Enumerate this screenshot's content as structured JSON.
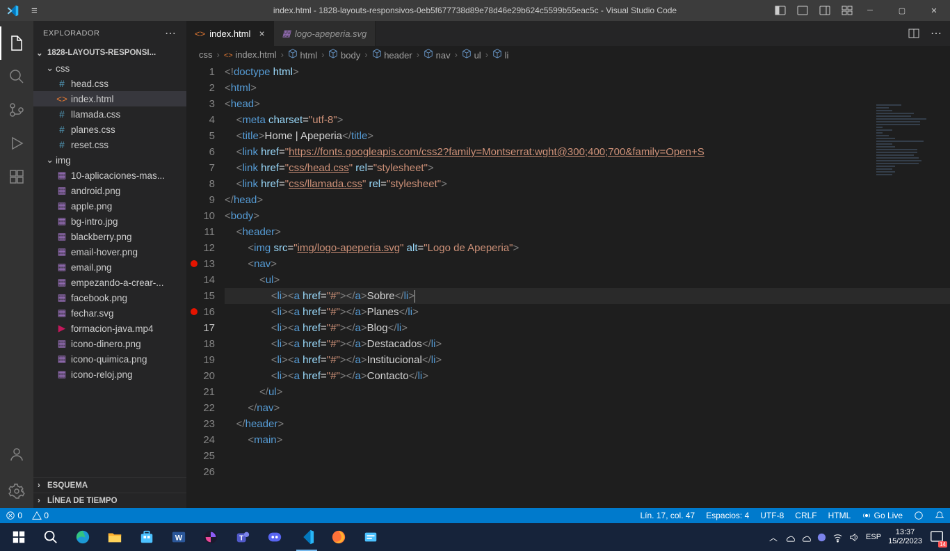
{
  "titlebar": {
    "title": "index.html - 1828-layouts-responsivos-0eb5f677738d89e78d46e29b624c5599b55eac5c - Visual Studio Code"
  },
  "sidebar": {
    "header": "EXPLORADOR",
    "root": "1828-LAYOUTS-RESPONSI...",
    "folders": [
      {
        "name": "css",
        "children": [
          "head.css",
          "index.html",
          "llamada.css",
          "planes.css",
          "reset.css"
        ]
      },
      {
        "name": "img",
        "children": [
          "10-aplicaciones-mas...",
          "android.png",
          "apple.png",
          "bg-intro.jpg",
          "blackberry.png",
          "email-hover.png",
          "email.png",
          "empezando-a-crear-...",
          "facebook.png",
          "fechar.svg",
          "formacion-java.mp4",
          "icono-dinero.png",
          "icono-quimica.png",
          "icono-reloj.png"
        ]
      }
    ],
    "footer": [
      "ESQUEMA",
      "LÍNEA DE TIEMPO"
    ]
  },
  "tabs": [
    {
      "name": "index.html",
      "active": true,
      "icon": "html"
    },
    {
      "name": "logo-apeperia.svg",
      "active": false,
      "icon": "svg"
    }
  ],
  "breadcrumbs": [
    "css",
    "index.html",
    "html",
    "body",
    "header",
    "nav",
    "ul",
    "li"
  ],
  "gutter": {
    "lines": 26,
    "breakpoints": [
      13,
      16
    ],
    "current": 17
  },
  "code": {
    "lines": [
      [
        {
          "c": "tk-gray",
          "t": "<!"
        },
        {
          "c": "tk-tag",
          "t": "doctype "
        },
        {
          "c": "tk-attr",
          "t": "html"
        },
        {
          "c": "tk-gray",
          "t": ">"
        }
      ],
      [
        {
          "c": "tk-gray",
          "t": "<"
        },
        {
          "c": "tk-tag",
          "t": "html"
        },
        {
          "c": "tk-gray",
          "t": ">"
        }
      ],
      [
        {
          "c": "tk-gray",
          "t": "<"
        },
        {
          "c": "tk-tag",
          "t": "head"
        },
        {
          "c": "tk-gray",
          "t": ">"
        }
      ],
      [
        {
          "c": "tk-txt",
          "t": "    "
        },
        {
          "c": "tk-gray",
          "t": "<"
        },
        {
          "c": "tk-tag",
          "t": "meta "
        },
        {
          "c": "tk-attr",
          "t": "charset"
        },
        {
          "c": "tk-txt",
          "t": "="
        },
        {
          "c": "tk-str",
          "t": "\"utf-8\""
        },
        {
          "c": "tk-gray",
          "t": ">"
        }
      ],
      [
        {
          "c": "tk-txt",
          "t": "    "
        },
        {
          "c": "tk-gray",
          "t": "<"
        },
        {
          "c": "tk-tag",
          "t": "title"
        },
        {
          "c": "tk-gray",
          "t": ">"
        },
        {
          "c": "tk-txt",
          "t": "Home | Apeperia"
        },
        {
          "c": "tk-gray",
          "t": "</"
        },
        {
          "c": "tk-tag",
          "t": "title"
        },
        {
          "c": "tk-gray",
          "t": ">"
        }
      ],
      [
        {
          "c": "tk-txt",
          "t": "    "
        },
        {
          "c": "tk-gray",
          "t": "<"
        },
        {
          "c": "tk-tag",
          "t": "link "
        },
        {
          "c": "tk-attr",
          "t": "href"
        },
        {
          "c": "tk-txt",
          "t": "="
        },
        {
          "c": "tk-str",
          "t": "\""
        },
        {
          "c": "tk-url",
          "t": "https://fonts.googleapis.com/css2?family=Montserrat:wght@300;400;700&family=Open+S"
        }
      ],
      [
        {
          "c": "tk-txt",
          "t": "    "
        },
        {
          "c": "tk-gray",
          "t": "<"
        },
        {
          "c": "tk-tag",
          "t": "link "
        },
        {
          "c": "tk-attr",
          "t": "href"
        },
        {
          "c": "tk-txt",
          "t": "="
        },
        {
          "c": "tk-str",
          "t": "\""
        },
        {
          "c": "tk-url",
          "t": "css/head.css"
        },
        {
          "c": "tk-str",
          "t": "\" "
        },
        {
          "c": "tk-attr",
          "t": "rel"
        },
        {
          "c": "tk-txt",
          "t": "="
        },
        {
          "c": "tk-str",
          "t": "\"stylesheet\""
        },
        {
          "c": "tk-gray",
          "t": ">"
        }
      ],
      [
        {
          "c": "tk-txt",
          "t": "    "
        },
        {
          "c": "tk-gray",
          "t": "<"
        },
        {
          "c": "tk-tag",
          "t": "link "
        },
        {
          "c": "tk-attr",
          "t": "href"
        },
        {
          "c": "tk-txt",
          "t": "="
        },
        {
          "c": "tk-str",
          "t": "\""
        },
        {
          "c": "tk-url",
          "t": "css/llamada.css"
        },
        {
          "c": "tk-str",
          "t": "\" "
        },
        {
          "c": "tk-attr",
          "t": "rel"
        },
        {
          "c": "tk-txt",
          "t": "="
        },
        {
          "c": "tk-str",
          "t": "\"stylesheet\""
        },
        {
          "c": "tk-gray",
          "t": ">"
        }
      ],
      [
        {
          "c": "tk-txt",
          "t": ""
        }
      ],
      [
        {
          "c": "tk-gray",
          "t": "</"
        },
        {
          "c": "tk-tag",
          "t": "head"
        },
        {
          "c": "tk-gray",
          "t": ">"
        }
      ],
      [
        {
          "c": "tk-txt",
          "t": ""
        }
      ],
      [
        {
          "c": "tk-gray",
          "t": "<"
        },
        {
          "c": "tk-tag",
          "t": "body"
        },
        {
          "c": "tk-gray",
          "t": ">"
        }
      ],
      [
        {
          "c": "tk-txt",
          "t": "    "
        },
        {
          "c": "tk-gray",
          "t": "<"
        },
        {
          "c": "tk-tag",
          "t": "header"
        },
        {
          "c": "tk-gray",
          "t": ">"
        }
      ],
      [
        {
          "c": "tk-txt",
          "t": "        "
        },
        {
          "c": "tk-gray",
          "t": "<"
        },
        {
          "c": "tk-tag",
          "t": "img "
        },
        {
          "c": "tk-attr",
          "t": "src"
        },
        {
          "c": "tk-txt",
          "t": "="
        },
        {
          "c": "tk-str",
          "t": "\""
        },
        {
          "c": "tk-url",
          "t": "img/logo-apeperia.svg"
        },
        {
          "c": "tk-str",
          "t": "\" "
        },
        {
          "c": "tk-attr",
          "t": "alt"
        },
        {
          "c": "tk-txt",
          "t": "="
        },
        {
          "c": "tk-str",
          "t": "\"Logo de Apeperia\""
        },
        {
          "c": "tk-gray",
          "t": ">"
        }
      ],
      [
        {
          "c": "tk-txt",
          "t": "        "
        },
        {
          "c": "tk-gray",
          "t": "<"
        },
        {
          "c": "tk-tag",
          "t": "nav"
        },
        {
          "c": "tk-gray",
          "t": ">"
        }
      ],
      [
        {
          "c": "tk-txt",
          "t": "            "
        },
        {
          "c": "tk-gray",
          "t": "<"
        },
        {
          "c": "tk-tag",
          "t": "ul"
        },
        {
          "c": "tk-gray",
          "t": ">"
        }
      ],
      [
        {
          "c": "tk-txt",
          "t": "                "
        },
        {
          "c": "tk-gray",
          "t": "<"
        },
        {
          "c": "tk-tag",
          "t": "li"
        },
        {
          "c": "tk-gray",
          "t": "><"
        },
        {
          "c": "tk-tag",
          "t": "a "
        },
        {
          "c": "tk-attr",
          "t": "href"
        },
        {
          "c": "tk-txt",
          "t": "="
        },
        {
          "c": "tk-str",
          "t": "\"#\""
        },
        {
          "c": "tk-gray",
          "t": "></"
        },
        {
          "c": "tk-tag",
          "t": "a"
        },
        {
          "c": "tk-gray",
          "t": ">"
        },
        {
          "c": "tk-txt",
          "t": "Sobre"
        },
        {
          "c": "tk-gray",
          "t": "</"
        },
        {
          "c": "tk-tag",
          "t": "li"
        },
        {
          "c": "tk-gray",
          "t": ">"
        }
      ],
      [
        {
          "c": "tk-txt",
          "t": "                "
        },
        {
          "c": "tk-gray",
          "t": "<"
        },
        {
          "c": "tk-tag",
          "t": "li"
        },
        {
          "c": "tk-gray",
          "t": "><"
        },
        {
          "c": "tk-tag",
          "t": "a "
        },
        {
          "c": "tk-attr",
          "t": "href"
        },
        {
          "c": "tk-txt",
          "t": "="
        },
        {
          "c": "tk-str",
          "t": "\"#\""
        },
        {
          "c": "tk-gray",
          "t": "></"
        },
        {
          "c": "tk-tag",
          "t": "a"
        },
        {
          "c": "tk-gray",
          "t": ">"
        },
        {
          "c": "tk-txt",
          "t": "Planes"
        },
        {
          "c": "tk-gray",
          "t": "</"
        },
        {
          "c": "tk-tag",
          "t": "li"
        },
        {
          "c": "tk-gray",
          "t": ">"
        }
      ],
      [
        {
          "c": "tk-txt",
          "t": "                "
        },
        {
          "c": "tk-gray",
          "t": "<"
        },
        {
          "c": "tk-tag",
          "t": "li"
        },
        {
          "c": "tk-gray",
          "t": "><"
        },
        {
          "c": "tk-tag",
          "t": "a "
        },
        {
          "c": "tk-attr",
          "t": "href"
        },
        {
          "c": "tk-txt",
          "t": "="
        },
        {
          "c": "tk-str",
          "t": "\"#\""
        },
        {
          "c": "tk-gray",
          "t": "></"
        },
        {
          "c": "tk-tag",
          "t": "a"
        },
        {
          "c": "tk-gray",
          "t": ">"
        },
        {
          "c": "tk-txt",
          "t": "Blog"
        },
        {
          "c": "tk-gray",
          "t": "</"
        },
        {
          "c": "tk-tag",
          "t": "li"
        },
        {
          "c": "tk-gray",
          "t": ">"
        }
      ],
      [
        {
          "c": "tk-txt",
          "t": "                "
        },
        {
          "c": "tk-gray",
          "t": "<"
        },
        {
          "c": "tk-tag",
          "t": "li"
        },
        {
          "c": "tk-gray",
          "t": "><"
        },
        {
          "c": "tk-tag",
          "t": "a "
        },
        {
          "c": "tk-attr",
          "t": "href"
        },
        {
          "c": "tk-txt",
          "t": "="
        },
        {
          "c": "tk-str",
          "t": "\"#\""
        },
        {
          "c": "tk-gray",
          "t": "></"
        },
        {
          "c": "tk-tag",
          "t": "a"
        },
        {
          "c": "tk-gray",
          "t": ">"
        },
        {
          "c": "tk-txt",
          "t": "Destacados"
        },
        {
          "c": "tk-gray",
          "t": "</"
        },
        {
          "c": "tk-tag",
          "t": "li"
        },
        {
          "c": "tk-gray",
          "t": ">"
        }
      ],
      [
        {
          "c": "tk-txt",
          "t": "                "
        },
        {
          "c": "tk-gray",
          "t": "<"
        },
        {
          "c": "tk-tag",
          "t": "li"
        },
        {
          "c": "tk-gray",
          "t": "><"
        },
        {
          "c": "tk-tag",
          "t": "a "
        },
        {
          "c": "tk-attr",
          "t": "href"
        },
        {
          "c": "tk-txt",
          "t": "="
        },
        {
          "c": "tk-str",
          "t": "\"#\""
        },
        {
          "c": "tk-gray",
          "t": "></"
        },
        {
          "c": "tk-tag",
          "t": "a"
        },
        {
          "c": "tk-gray",
          "t": ">"
        },
        {
          "c": "tk-txt",
          "t": "Institucional"
        },
        {
          "c": "tk-gray",
          "t": "</"
        },
        {
          "c": "tk-tag",
          "t": "li"
        },
        {
          "c": "tk-gray",
          "t": ">"
        }
      ],
      [
        {
          "c": "tk-txt",
          "t": "                "
        },
        {
          "c": "tk-gray",
          "t": "<"
        },
        {
          "c": "tk-tag",
          "t": "li"
        },
        {
          "c": "tk-gray",
          "t": "><"
        },
        {
          "c": "tk-tag",
          "t": "a "
        },
        {
          "c": "tk-attr",
          "t": "href"
        },
        {
          "c": "tk-txt",
          "t": "="
        },
        {
          "c": "tk-str",
          "t": "\"#\""
        },
        {
          "c": "tk-gray",
          "t": "></"
        },
        {
          "c": "tk-tag",
          "t": "a"
        },
        {
          "c": "tk-gray",
          "t": ">"
        },
        {
          "c": "tk-txt",
          "t": "Contacto"
        },
        {
          "c": "tk-gray",
          "t": "</"
        },
        {
          "c": "tk-tag",
          "t": "li"
        },
        {
          "c": "tk-gray",
          "t": ">"
        }
      ],
      [
        {
          "c": "tk-txt",
          "t": "            "
        },
        {
          "c": "tk-gray",
          "t": "</"
        },
        {
          "c": "tk-tag",
          "t": "ul"
        },
        {
          "c": "tk-gray",
          "t": ">"
        }
      ],
      [
        {
          "c": "tk-txt",
          "t": "        "
        },
        {
          "c": "tk-gray",
          "t": "</"
        },
        {
          "c": "tk-tag",
          "t": "nav"
        },
        {
          "c": "tk-gray",
          "t": ">"
        }
      ],
      [
        {
          "c": "tk-txt",
          "t": "    "
        },
        {
          "c": "tk-gray",
          "t": "</"
        },
        {
          "c": "tk-tag",
          "t": "header"
        },
        {
          "c": "tk-gray",
          "t": ">"
        }
      ],
      [
        {
          "c": "tk-txt",
          "t": "        "
        },
        {
          "c": "tk-gray",
          "t": "<"
        },
        {
          "c": "tk-tag",
          "t": "main"
        },
        {
          "c": "tk-gray",
          "t": ">"
        }
      ]
    ]
  },
  "statusbar": {
    "errors": "0",
    "warnings": "0",
    "cursor": "Lín. 17, col. 47",
    "spaces": "Espacios: 4",
    "encoding": "UTF-8",
    "eol": "CRLF",
    "lang": "HTML",
    "golive": "Go Live"
  },
  "taskbar": {
    "time": "13:37",
    "date": "15/2/2023",
    "lang": "ESP",
    "notif": "14"
  }
}
